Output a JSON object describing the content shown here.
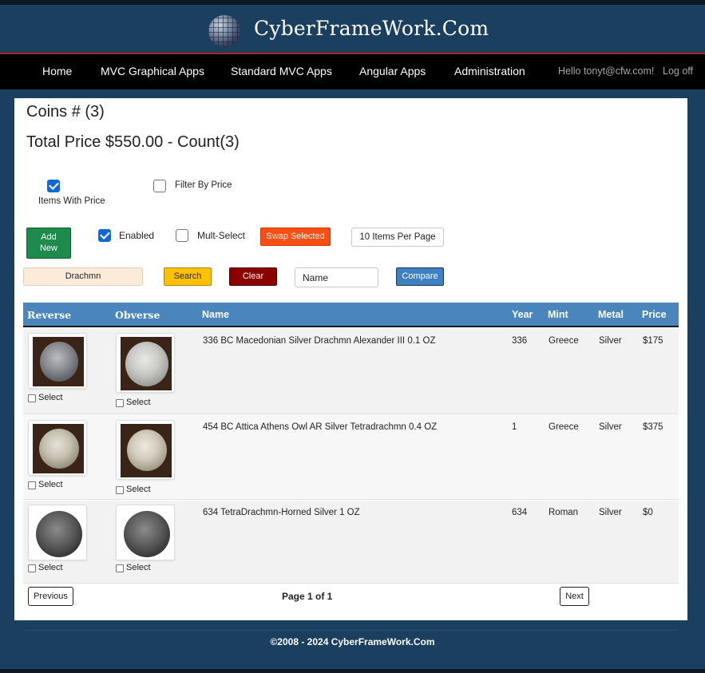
{
  "brand": {
    "title": "CyberFrameWork.Com",
    "logo_icon": "globe-icon"
  },
  "nav": {
    "items": [
      {
        "label": "Home"
      },
      {
        "label": "MVC Graphical Apps"
      },
      {
        "label": "Standard MVC Apps"
      },
      {
        "label": "Angular Apps"
      },
      {
        "label": "Administration"
      }
    ],
    "user_greeting": "Hello tonyt@cfw.com!",
    "logout_label": "Log off"
  },
  "main": {
    "coins_heading": "Coins # (3)",
    "total_heading": "Total Price $550.00 - Count(3)"
  },
  "filters": {
    "items_with_price": {
      "label": "Items With Price",
      "checked": true
    },
    "filter_by_price": {
      "label": "Filter By Price",
      "checked": false
    },
    "enabled": {
      "label": "Enabled",
      "checked": true
    },
    "multi_select": {
      "label": "Mult-Select",
      "checked": false
    }
  },
  "toolbar": {
    "add_new_label_line1": "Add",
    "add_new_label_line2": "New",
    "swap_selected_label": "Swap Selected",
    "items_per_page": "10 Items Per Page",
    "search_value": "Drachmn",
    "search_label": "Search",
    "clear_label": "Clear",
    "name_value": "Name",
    "compare_label": "Compare"
  },
  "table": {
    "columns": [
      "Reverse",
      "Obverse",
      "Name",
      "Year",
      "Mint",
      "Metal",
      "Price"
    ],
    "select_label": "Select",
    "rows": [
      {
        "name": "336 BC Macedonian Silver Drachmn Alexander III 0.1 OZ",
        "year": "336",
        "mint": "Greece",
        "metal": "Silver",
        "price": "$175"
      },
      {
        "name": "454 BC Attica Athens Owl AR Silver Tetradrachmn 0.4 OZ",
        "year": "1",
        "mint": "Greece",
        "metal": "Silver",
        "price": "$375"
      },
      {
        "name": "634 TetraDrachmn-Horned Silver 1 OZ",
        "year": "634",
        "mint": "Roman",
        "metal": "Silver",
        "price": "$0"
      }
    ]
  },
  "pager": {
    "previous_label": "Previous",
    "page_info": "Page 1 of 1",
    "next_label": "Next"
  },
  "footer": {
    "copyright": "©2008 - 2024 CyberFrameWork.Com"
  },
  "colors": {
    "header_bg": "#1b3f5e",
    "navbar_bg": "#000000",
    "table_header_bg": "#4a86bc",
    "add_button": "#1e8a4c",
    "swap_button": "#ff4e12",
    "search_button": "#ffc107",
    "clear_button": "#8b0000",
    "compare_button": "#3f80c2"
  }
}
